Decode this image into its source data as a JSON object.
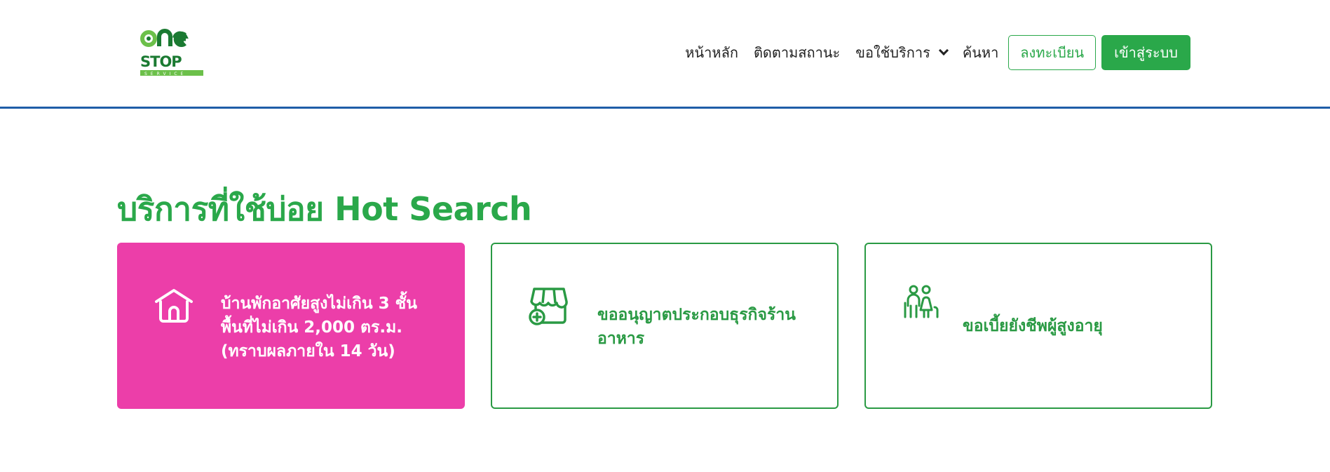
{
  "brand": {
    "logo_alt": "One Stop Service",
    "logo_text_top": "ONE",
    "logo_text_bottom": "STOP",
    "logo_tag": "SERVICE",
    "colors": {
      "dark_green": "#1b7a32",
      "light_green": "#6cc04a"
    }
  },
  "nav": {
    "items": [
      {
        "label": "หน้าหลัก",
        "icon": null
      },
      {
        "label": "ติดตามสถานะ",
        "icon": null
      },
      {
        "label": "ขอใช้บริการ",
        "icon": "chevron-down-icon"
      },
      {
        "label": "ค้นหา",
        "icon": null
      }
    ],
    "register_label": "ลงทะเบียน",
    "login_label": "เข้าสู่ระบบ"
  },
  "hot_search": {
    "title": "บริการที่ใช้บ่อย Hot Search",
    "cards": [
      {
        "icon": "house-icon",
        "lines": [
          "บ้านพักอาศัยสูงไม่เกิน 3 ชั้น",
          "พื้นที่ไม่เกิน 2,000 ตร.ม.",
          "(ทราบผลภายใน 14 วัน)"
        ],
        "style": "highlight"
      },
      {
        "icon": "shop-license-icon",
        "lines": [
          "ขออนุญาตประกอบธุรกิจร้าน",
          "อาหาร"
        ],
        "style": "outline"
      },
      {
        "icon": "elderly-couple-icon",
        "lines": [
          "ขอเบี้ยยังชีพผู้สูงอายุ"
        ],
        "style": "outline"
      }
    ]
  },
  "theme": {
    "accent": "#2aa84a",
    "highlight_card": "#ec3ea9",
    "header_border": "#1f5ea8"
  }
}
